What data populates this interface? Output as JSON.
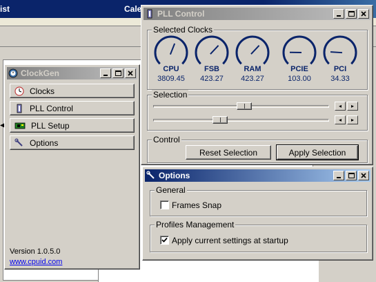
{
  "background": {
    "title_left": "ist",
    "title_right": "Cale",
    "arrow": "◀"
  },
  "clockgen": {
    "title": "ClockGen",
    "menu": [
      {
        "label": "Clocks",
        "icon": "clock-icon"
      },
      {
        "label": "PLL Control",
        "icon": "pll-chip-icon"
      },
      {
        "label": "PLL Setup",
        "icon": "circuit-board-icon"
      },
      {
        "label": "Options",
        "icon": "options-wrench-icon"
      }
    ],
    "version": "Version 1.0.5.0",
    "website": "www.cpuid.com"
  },
  "pll": {
    "title": "PLL Control",
    "selected_clocks_label": "Selected Clocks",
    "gauges": [
      {
        "name": "CPU",
        "value": "3809.45",
        "level": 0.58
      },
      {
        "name": "FSB",
        "value": "423.27",
        "level": 0.66
      },
      {
        "name": "RAM",
        "value": "423.27",
        "level": 0.66
      },
      {
        "name": "PCIE",
        "value": "103.00",
        "level": 0.17
      },
      {
        "name": "PCI",
        "value": "34.33",
        "level": 0.18
      }
    ],
    "selection_label": "Selection",
    "sliders": [
      {
        "position": 0.52
      },
      {
        "position": 0.37
      }
    ],
    "spin_left": "◂",
    "spin_right": "▸",
    "control_label": "Control",
    "reset_button": "Reset Selection",
    "apply_button": "Apply Selection"
  },
  "options": {
    "title": "Options",
    "general_label": "General",
    "frames_snap_label": "Frames Snap",
    "frames_snap_checked": false,
    "profiles_label": "Profiles Management",
    "apply_startup_label": "Apply current settings at startup",
    "apply_startup_checked": true
  },
  "colors": {
    "active_title": "#0a246a",
    "gauge_blue": "#0a246a",
    "face": "#d4d0c8"
  }
}
